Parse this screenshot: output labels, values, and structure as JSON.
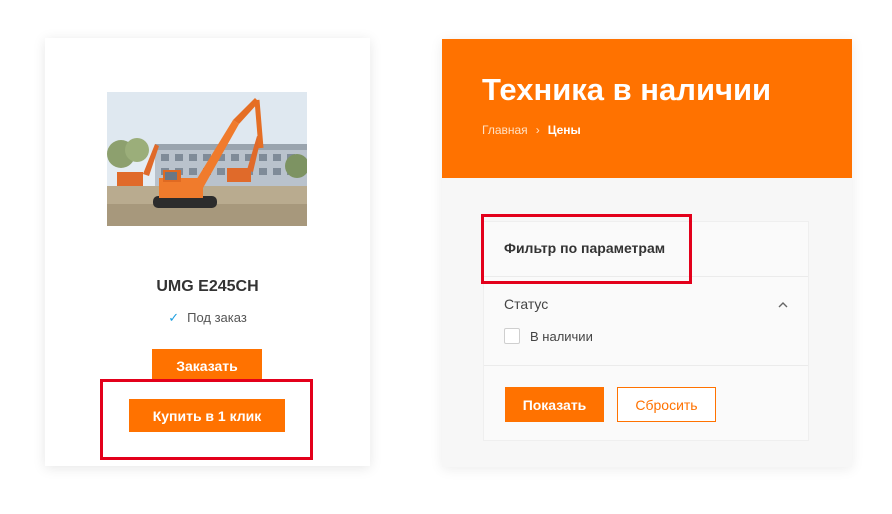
{
  "product": {
    "name": "UMG E245CH",
    "availability": "Под заказ",
    "order_label": "Заказать",
    "one_click_label": "Купить в 1 клик",
    "photo_icon": "excavator-photo"
  },
  "catalog": {
    "title": "Техника в наличии",
    "breadcrumb": {
      "home": "Главная",
      "separator": "›",
      "current": "Цены"
    },
    "filter": {
      "title": "Фильтр по параметрам",
      "group_label": "Статус",
      "option_label": "В наличии",
      "option_checked": false,
      "show_label": "Показать",
      "reset_label": "Сбросить"
    }
  },
  "colors": {
    "accent": "#ff7200",
    "check": "#1e9fe0",
    "highlight": "#e3001b"
  }
}
